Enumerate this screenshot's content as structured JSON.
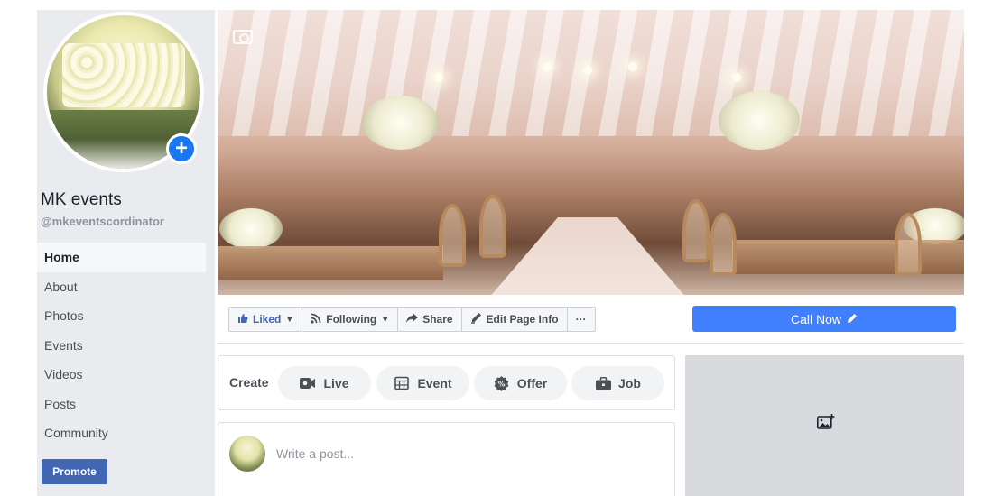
{
  "page": {
    "name": "MK events",
    "handle": "@mkeventscordinator"
  },
  "sidebar": {
    "items": [
      {
        "label": "Home",
        "active": true
      },
      {
        "label": "About"
      },
      {
        "label": "Photos"
      },
      {
        "label": "Events"
      },
      {
        "label": "Videos"
      },
      {
        "label": "Posts"
      },
      {
        "label": "Community"
      }
    ],
    "promote_label": "Promote"
  },
  "actions": {
    "liked_label": "Liked",
    "following_label": "Following",
    "share_label": "Share",
    "edit_label": "Edit Page Info",
    "more_label": "···",
    "call_now_label": "Call Now"
  },
  "create": {
    "label": "Create",
    "options": [
      {
        "label": "Live",
        "icon": "video-camera-icon"
      },
      {
        "label": "Event",
        "icon": "calendar-icon"
      },
      {
        "label": "Offer",
        "icon": "offer-tag-icon"
      },
      {
        "label": "Job",
        "icon": "briefcase-icon"
      }
    ]
  },
  "composer": {
    "placeholder": "Write a post..."
  },
  "colors": {
    "brand": "#4267b2",
    "call_now": "#4080ff",
    "sidebar_bg": "#e9ebee",
    "panel_placeholder": "#d8dade"
  }
}
